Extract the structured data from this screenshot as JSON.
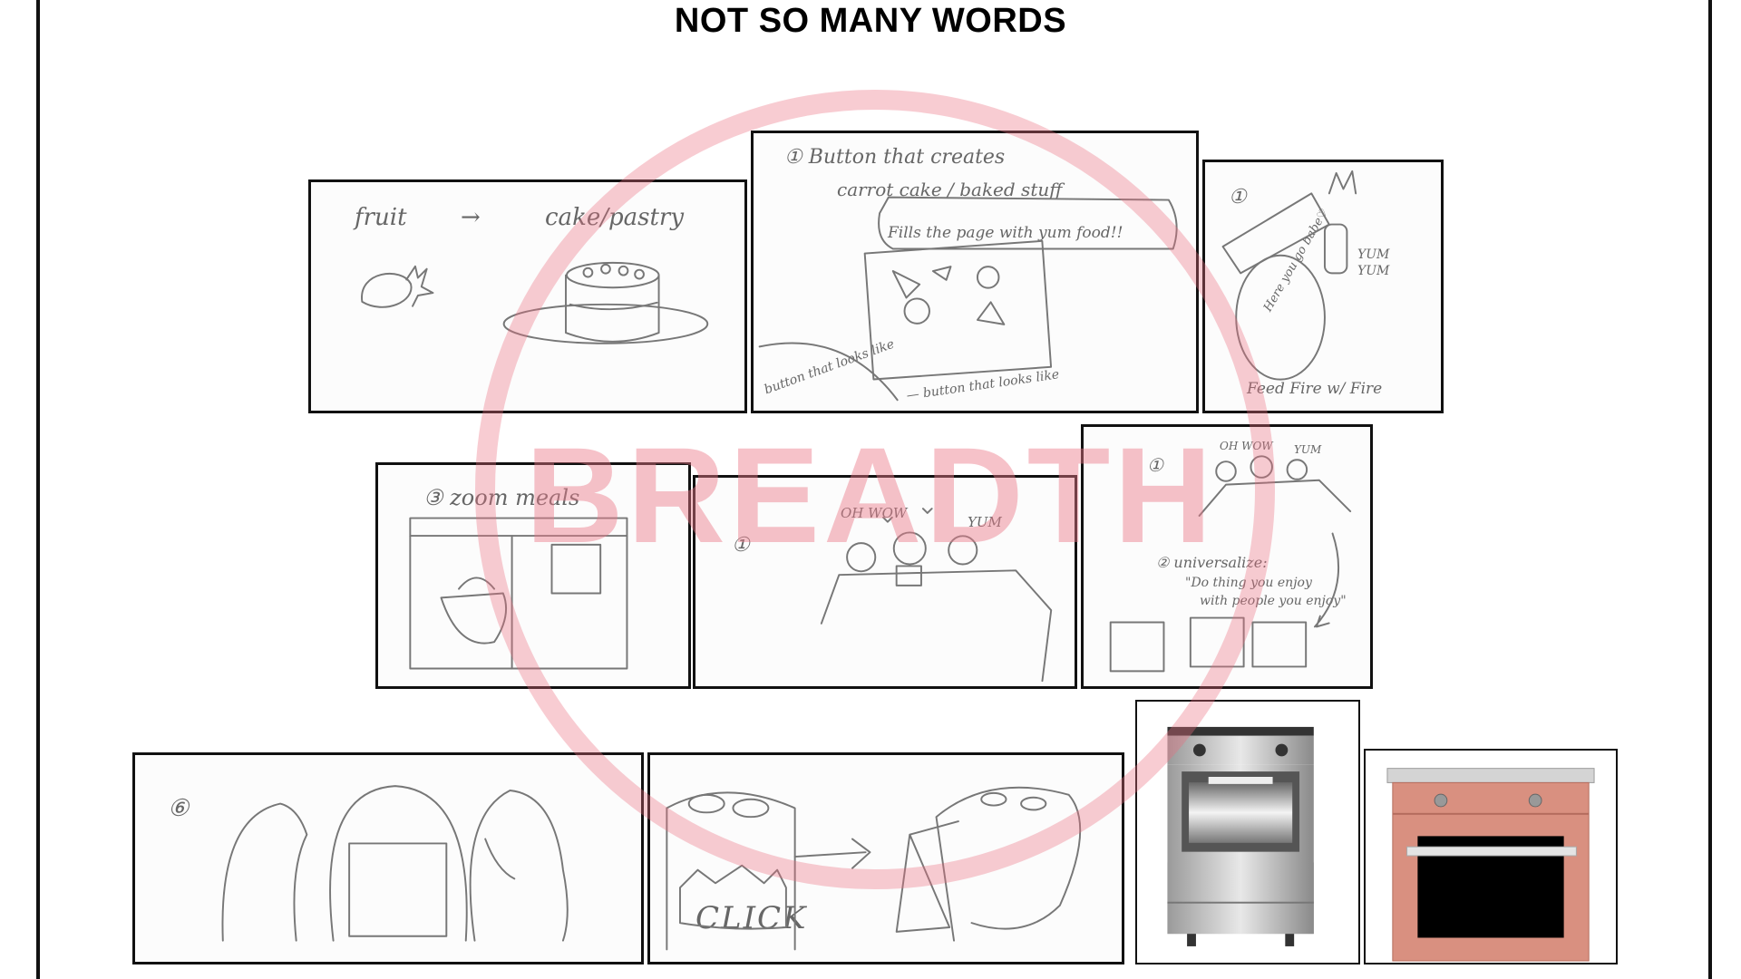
{
  "title": "NOT SO MANY WORDS",
  "watermark": "BREADTH",
  "watermark_color": "#f0a0aa",
  "panels": {
    "p1": {
      "labels": [
        "fruit",
        "cake/pastry"
      ]
    },
    "p2": {
      "labels": [
        "① Button that creates",
        "carrot cake / baked stuff",
        "Fills the page with yum food!!",
        "button that looks like",
        "— button that looks like"
      ]
    },
    "p3": {
      "labels": [
        "①",
        "YUM",
        "YUM",
        "Here you go babe♡",
        "Feed Fire w/ Fire"
      ]
    },
    "p4": {
      "labels": [
        "③ zoom meals"
      ]
    },
    "p5": {
      "labels": [
        "①",
        "OH WOW",
        "YUM"
      ]
    },
    "p6": {
      "labels": [
        "①",
        "OH WOW",
        "YUM",
        "② universalize:",
        "\"Do thing you enjoy",
        "with people you enjoy\""
      ]
    },
    "p7": {
      "labels": [
        "⑥"
      ]
    },
    "p8": {
      "labels": [
        "CLICK"
      ]
    },
    "p9": {
      "labels": []
    },
    "p10": {
      "labels": []
    }
  }
}
